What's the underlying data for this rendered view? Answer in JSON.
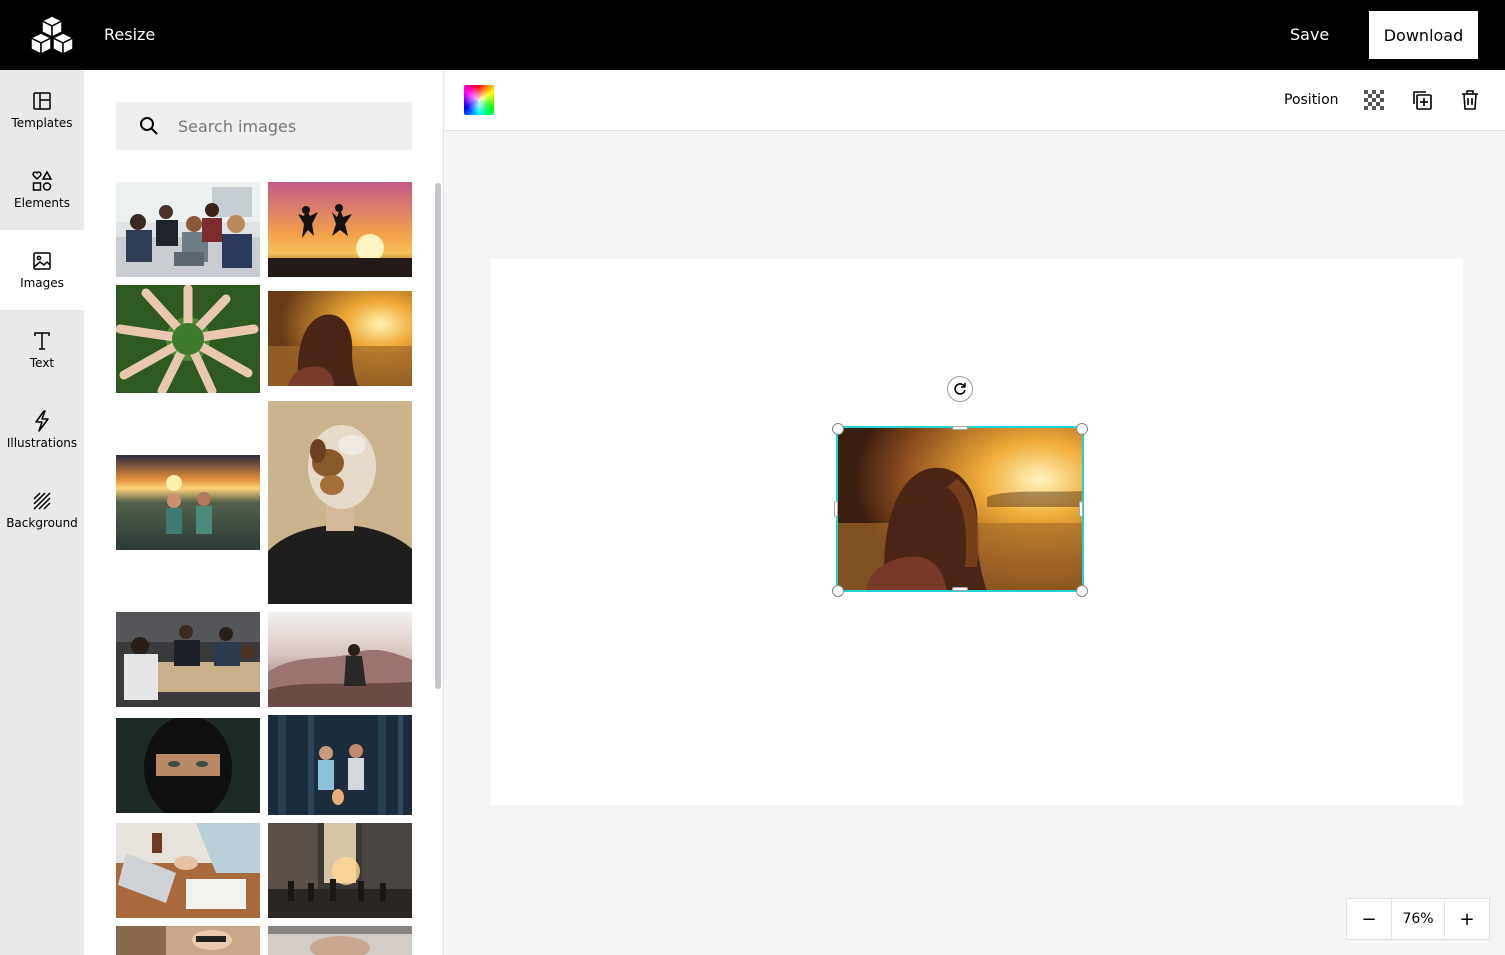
{
  "header": {
    "resize_label": "Resize",
    "save_label": "Save",
    "download_label": "Download"
  },
  "sidebar": {
    "items": [
      {
        "label": "Templates",
        "icon": "templates-icon",
        "active": false
      },
      {
        "label": "Elements",
        "icon": "elements-icon",
        "active": false
      },
      {
        "label": "Images",
        "icon": "images-icon",
        "active": true
      },
      {
        "label": "Text",
        "icon": "text-icon",
        "active": false
      },
      {
        "label": "Illustrations",
        "icon": "illustrations-icon",
        "active": false
      },
      {
        "label": "Background",
        "icon": "background-icon",
        "active": false
      }
    ]
  },
  "search": {
    "placeholder": "Search images",
    "value": ""
  },
  "toolbar": {
    "position_label": "Position"
  },
  "zoom": {
    "minus_label": "−",
    "value": "76%",
    "plus_label": "+"
  },
  "colors": {
    "topbar": "#000000",
    "selection": "#22d3d3",
    "canvas_bg": "#f4f5f7"
  }
}
